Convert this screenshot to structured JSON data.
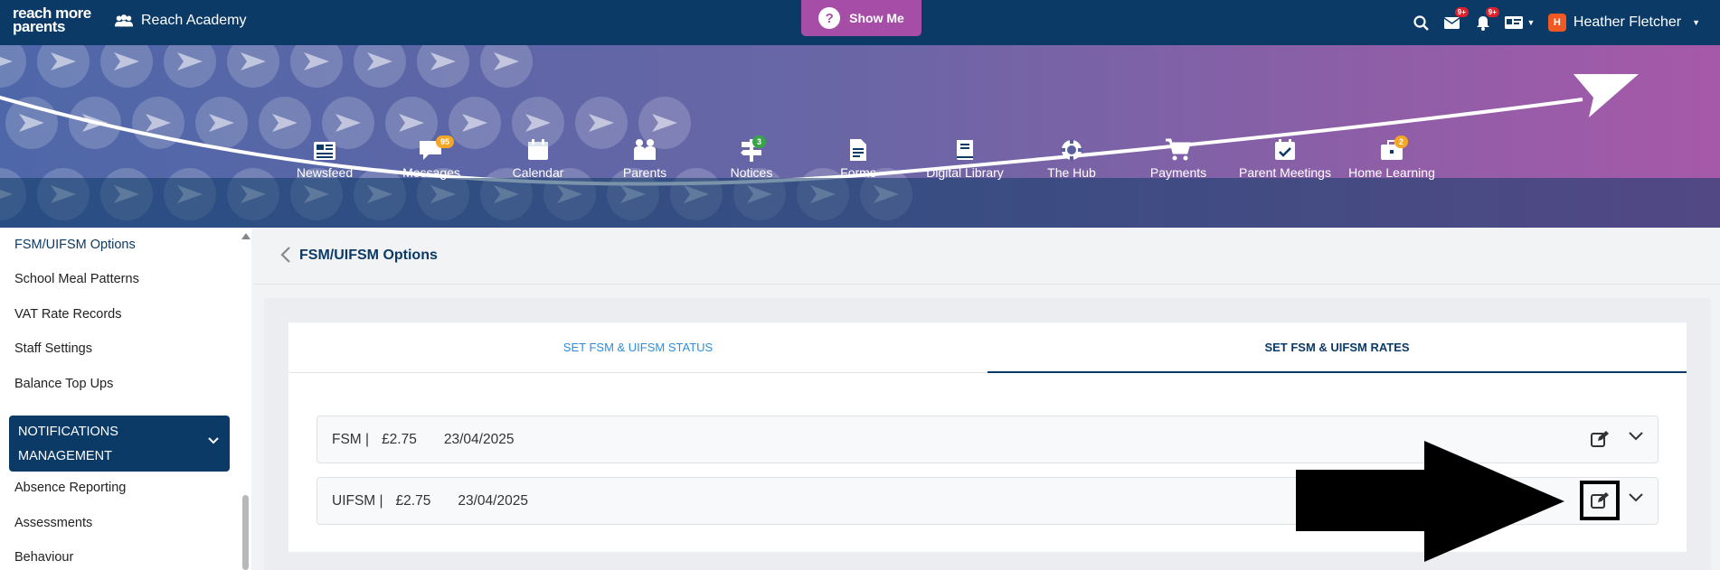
{
  "topbar": {
    "logo_line1": "reach more",
    "logo_line2": "parents",
    "school_name": "Reach Academy",
    "show_me_label": "Show Me",
    "show_me_glyph": "?",
    "mail_badge": "9+",
    "bell_badge": "9+",
    "user_initial": "H",
    "user_name": "Heather Fletcher",
    "icons": [
      "search-icon",
      "mail-icon",
      "bell-icon",
      "id-card-icon",
      "chevron-down-icon"
    ]
  },
  "nav": {
    "items": [
      {
        "label": "Newsfeed",
        "icon": "newspaper-icon"
      },
      {
        "label": "Messages",
        "icon": "chat-icon",
        "badge": "95"
      },
      {
        "label": "Calendar",
        "icon": "calendar-icon"
      },
      {
        "label": "Parents",
        "icon": "family-icon"
      },
      {
        "label": "Notices",
        "icon": "signpost-icon",
        "badge": "3"
      },
      {
        "label": "Forms",
        "icon": "document-icon"
      },
      {
        "label": "Digital Library",
        "icon": "book-icon"
      },
      {
        "label": "The Hub",
        "icon": "lifebuoy-icon"
      },
      {
        "label": "Payments",
        "icon": "cart-icon"
      },
      {
        "label": "Parent Meetings",
        "icon": "calendar-check-icon"
      },
      {
        "label": "Home Learning",
        "icon": "briefcase-icon",
        "badge": "2"
      }
    ],
    "colors": {
      "orange_badge": "#f5a623",
      "green_badge": "#3aa548"
    }
  },
  "sidebar": {
    "items": [
      {
        "label": "FSM/UIFSM Options",
        "active": true
      },
      {
        "label": "School Meal Patterns"
      },
      {
        "label": "VAT Rate Records"
      },
      {
        "label": "Staff Settings"
      },
      {
        "label": "Balance Top Ups"
      }
    ],
    "section": {
      "line1": "NOTIFICATIONS",
      "line2": "MANAGEMENT"
    },
    "sub_items": [
      {
        "label": "Absence Reporting"
      },
      {
        "label": "Assessments"
      },
      {
        "label": "Behaviour"
      }
    ]
  },
  "main": {
    "title": "FSM/UIFSM Options",
    "tabs": [
      {
        "label": "SET FSM & UIFSM STATUS",
        "active": false
      },
      {
        "label": "SET FSM & UIFSM RATES",
        "active": true
      }
    ],
    "rows": [
      {
        "type": "FSM |",
        "amount": "£2.75",
        "date": "23/04/2025"
      },
      {
        "type": "UIFSM |",
        "amount": "£2.75",
        "date": "23/04/2025"
      }
    ]
  },
  "colors": {
    "primary": "#0c3a66",
    "accent_purple": "#a64da8",
    "link_blue": "#2e8de0",
    "badge_red": "#e0202c"
  }
}
